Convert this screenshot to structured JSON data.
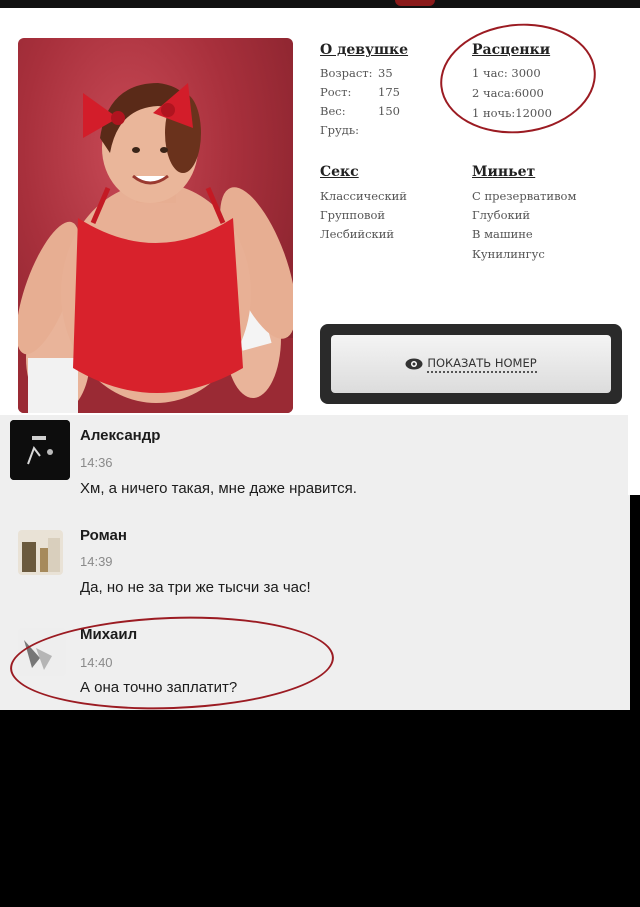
{
  "profile": {
    "about": {
      "title": "О девушке",
      "rows": [
        {
          "key": "Возраст:",
          "value": "35"
        },
        {
          "key": "Рост:",
          "value": "175"
        },
        {
          "key": "Вес:",
          "value": "150"
        },
        {
          "key": "Грудь:",
          "value": ""
        }
      ]
    },
    "prices": {
      "title": "Расценки",
      "rows": [
        "1 час: 3000",
        "2 часа:6000",
        "1 ночь:12000"
      ]
    },
    "sex": {
      "title": "Секс",
      "rows": [
        "Классический",
        "Групповой",
        "Лесбийский"
      ]
    },
    "oral": {
      "title": "Миньет",
      "rows": [
        "С презервативом",
        "Глубокий",
        "В машине",
        "Кунилингус"
      ]
    },
    "show_number_label": "ПОКАЗАТЬ НОМЕР",
    "colors": {
      "accent_red": "#9b1b22",
      "photo_bg": "#a8303c"
    }
  },
  "comments": [
    {
      "author": "Александр",
      "time": "14:36",
      "text": "Хм, а ничего такая, мне даже нравится."
    },
    {
      "author": "Роман",
      "time": "14:39",
      "text": "Да, но не за три же тысчи за час!"
    },
    {
      "author": "Михаил",
      "time": "14:40",
      "text": "А она точно заплатит?"
    }
  ]
}
